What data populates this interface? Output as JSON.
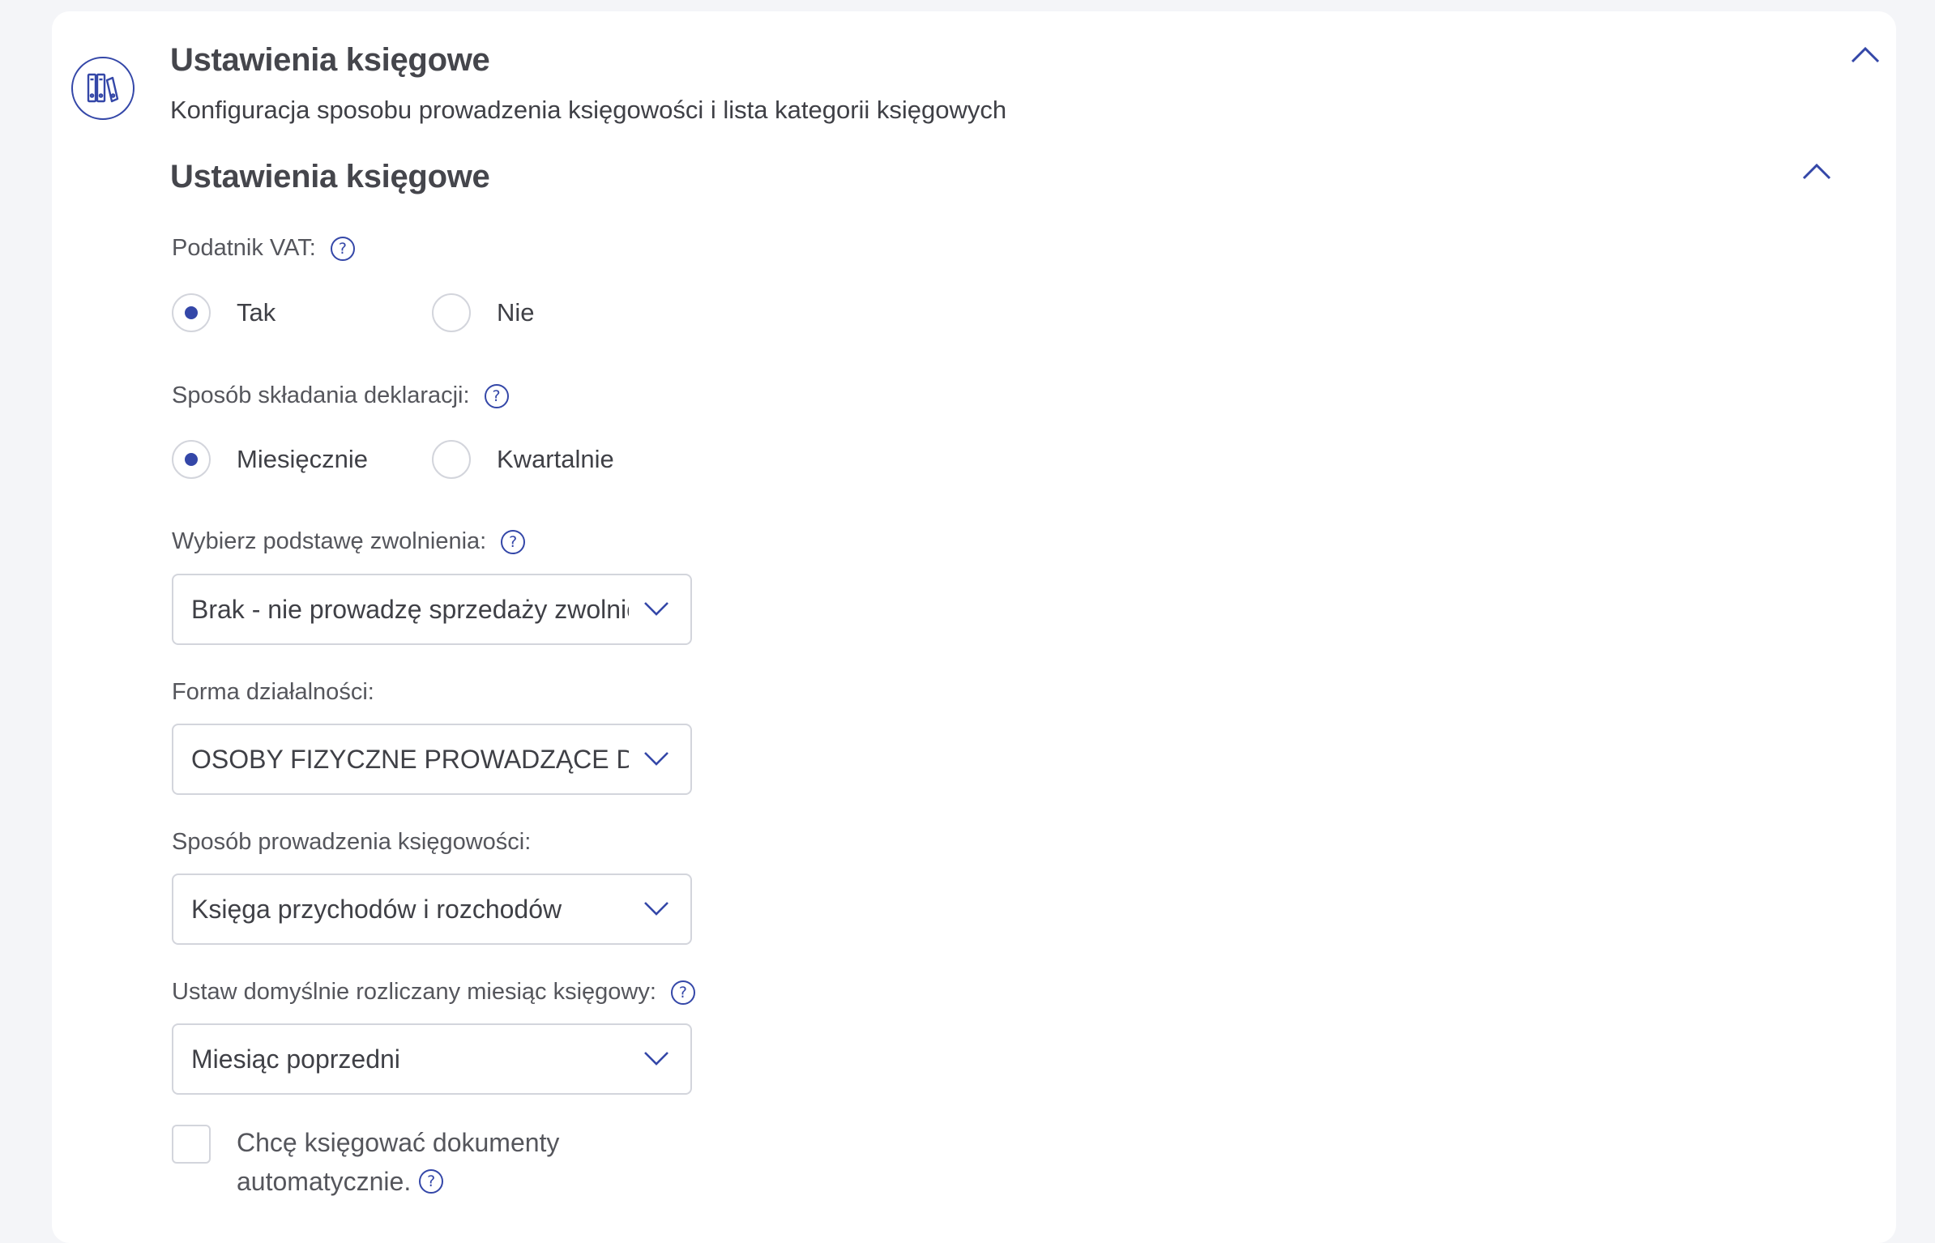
{
  "header": {
    "title": "Ustawienia księgowe",
    "description": "Konfiguracja sposobu prowadzenia księgowości i lista kategorii księgowych"
  },
  "section": {
    "title": "Ustawienia księgowe"
  },
  "vat": {
    "label": "Podatnik VAT:",
    "options": [
      {
        "label": "Tak",
        "selected": true
      },
      {
        "label": "Nie",
        "selected": false
      }
    ]
  },
  "declaration": {
    "label": "Sposób składania deklaracji:",
    "options": [
      {
        "label": "Miesięcznie",
        "selected": true
      },
      {
        "label": "Kwartalnie",
        "selected": false
      }
    ]
  },
  "exemption": {
    "label": "Wybierz podstawę zwolnienia:",
    "value": "Brak - nie prowadzę sprzedaży zwolnionej"
  },
  "business_form": {
    "label": "Forma działalności:",
    "value": "OSOBY FIZYCZNE PROWADZĄCE DZIAŁALNOŚĆ"
  },
  "accounting_method": {
    "label": "Sposób prowadzenia księgowości:",
    "value": "Księga przychodów i rozchodów"
  },
  "default_month": {
    "label": "Ustaw domyślnie rozliczany miesiąc księgowy:",
    "value": "Miesiąc poprzedni"
  },
  "auto_booking": {
    "line1": "Chcę księgować dokumenty",
    "line2": "automatycznie.",
    "checked": false
  },
  "help_glyph": "?",
  "icons": {
    "section": "binders-icon",
    "collapse": "chevron-up-icon",
    "dropdown": "chevron-down-icon",
    "help": "help-icon"
  },
  "colors": {
    "accent": "#3447a8",
    "border": "#d3d5dc",
    "background": "#f4f5f8"
  }
}
